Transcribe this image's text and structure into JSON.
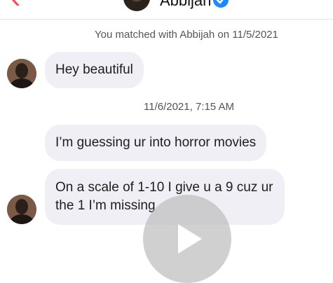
{
  "header": {
    "contact_name": "Abbijah",
    "back_icon": "chevron-left-icon",
    "verified_icon": "verified-badge-icon",
    "accent_color": "#ff4458",
    "verified_color": "#1e88ff"
  },
  "conversation": {
    "match_notice": "You matched with Abbijah on 11/5/2021",
    "timestamp": "11/6/2021, 7:15 AM",
    "messages": [
      {
        "text": "Hey beautiful"
      },
      {
        "text": "I’m guessing ur into horror movies"
      },
      {
        "text": "On a scale of 1-10 I give u a 9 cuz ur the 1 I’m missing"
      }
    ]
  },
  "overlay": {
    "icon": "play-icon"
  }
}
